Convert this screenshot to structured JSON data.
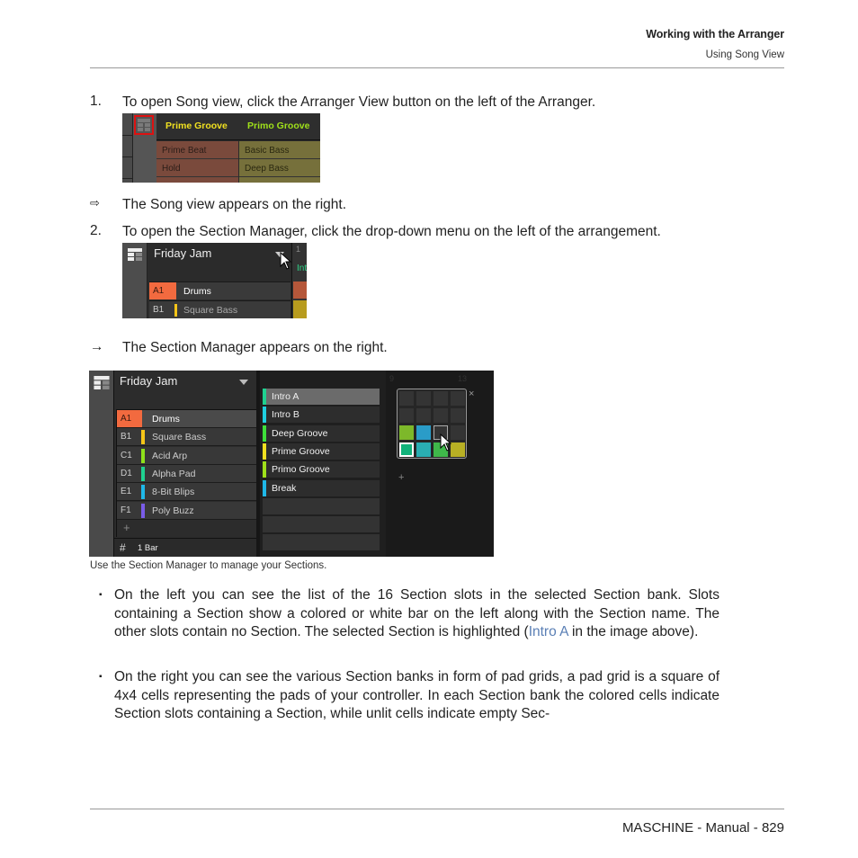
{
  "header": {
    "chapter": "Working with the Arranger",
    "section": "Using Song View"
  },
  "steps": [
    {
      "marker": "1.",
      "text": "To open Song view, click the Arranger View button on the left of the Arranger."
    },
    {
      "marker": "⇨",
      "text": "The Song view appears on the right."
    },
    {
      "marker": "2.",
      "text": "To open the Section Manager, click the drop-down menu on the left of the arrangement."
    },
    {
      "marker": "→",
      "text": "The Section Manager appears on the right."
    }
  ],
  "screenshot1": {
    "sections": [
      {
        "name": "Prime Groove",
        "color": "#f0e020"
      },
      {
        "name": "Primo Groove",
        "color": "#9fe01a"
      }
    ],
    "col_a": [
      "Prime Beat",
      "Hold"
    ],
    "col_b": [
      "Basic Bass",
      "Deep Bass"
    ]
  },
  "screenshot2": {
    "title": "Friday Jam",
    "ruler_number": "1",
    "section_label_partial": "Int",
    "rows": [
      {
        "id": "A1",
        "name": "Drums",
        "color": "#f26a3f"
      },
      {
        "id": "B1",
        "name": "Square Bass",
        "color": "#f5c518"
      }
    ]
  },
  "screenshot3": {
    "title": "Friday Jam",
    "groups": [
      {
        "id": "A1",
        "name": "Drums",
        "color": "#f26a3f",
        "selected": true
      },
      {
        "id": "B1",
        "name": "Square Bass",
        "color": "#f5c518"
      },
      {
        "id": "C1",
        "name": "Acid Arp",
        "color": "#8fe01a"
      },
      {
        "id": "D1",
        "name": "Alpha Pad",
        "color": "#1fd190"
      },
      {
        "id": "E1",
        "name": "8-Bit Blips",
        "color": "#1fb8e8"
      },
      {
        "id": "F1",
        "name": "Poly Buzz",
        "color": "#7a5ce8"
      }
    ],
    "add_label": "+",
    "grid_label": "1 Bar",
    "sections": [
      {
        "name": "Intro A",
        "color": "#1fd190",
        "selected": true
      },
      {
        "name": "Intro B",
        "color": "#1fd0e0"
      },
      {
        "name": "Deep Groove",
        "color": "#3ee03a"
      },
      {
        "name": "Prime Groove",
        "color": "#f0e020"
      },
      {
        "name": "Primo Groove",
        "color": "#9fe01a"
      },
      {
        "name": "Break",
        "color": "#1fb8e8"
      }
    ],
    "empty_slots": 3,
    "ruler_numbers": [
      "9",
      "13"
    ],
    "pad_grid": {
      "rows": [
        [
          "",
          "",
          "",
          ""
        ],
        [
          "",
          "",
          "",
          ""
        ],
        [
          "#7db82a",
          "#2a9cc8",
          "hover",
          ""
        ],
        [
          "#10b27a",
          "#2aaeb2",
          "#3fb84a",
          "#b8b024"
        ]
      ],
      "selected_pad": [
        3,
        0
      ]
    },
    "close_label": "×",
    "bank_add_label": "+"
  },
  "caption": "Use the Section Manager to manage your Sections.",
  "bullets": [
    {
      "before": "On the left you can see the list of the 16 Section slots in the selected Section bank. Slots containing a Section show a colored or white bar on the left along with the Section name. The other slots contain no Section. The selected Section is highlighted (",
      "link": "Intro A",
      "after": " in the image above)."
    },
    {
      "before": "On the right you can see the various Section banks in form of pad grids, a pad grid is a square of 4x4 cells representing the pads of your controller. In each Section bank the colored cells indicate Section slots containing a Section, while unlit cells indicate empty Sec-",
      "link": "",
      "after": ""
    }
  ],
  "footer": "MASCHINE - Manual - 829"
}
